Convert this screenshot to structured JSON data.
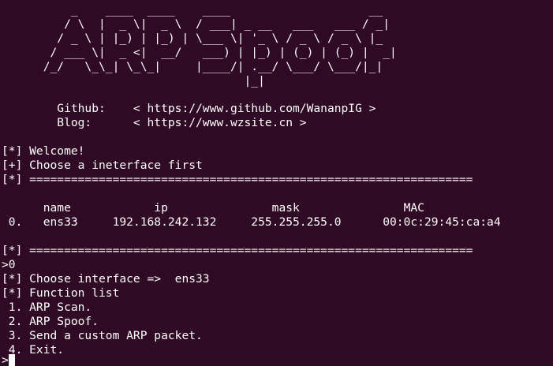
{
  "banner": [
    "          _    ____  ____    ____                    __",
    "         / \\  |  _ \\|  _ \\  / ___| _ __   ___   ___ / _|",
    "        / _ \\ | |_) | |_) | \\___ \\| '_ \\ / _ \\ / _ \\ |_",
    "       / ___ \\|  _ <|  __/   ___) | |_) | (_) | (_) |  _|",
    "      /_/   \\_\\_| \\_\\_|     |____/| .__/ \\___/ \\___/|_|",
    "                                   |_|"
  ],
  "links": {
    "github_line": "        Github:    < https://www.github.com/WananpIG >",
    "blog_line": "        Blog:      < https://www.wzsite.cn >"
  },
  "output": [
    "[*] Welcome!",
    "[+] Choose a ineterface first",
    "[*] ================================================================",
    "",
    "      name            ip               mask               MAC",
    " 0.   ens33     192.168.242.132     255.255.255.0      00:0c:29:45:ca:a4",
    "",
    "[*] ================================================================",
    ">0",
    "[*] Choose interface =>  ens33",
    "[*] Function list",
    " 1. ARP Scan.",
    " 2. ARP Spoof.",
    " 3. Send a custom ARP packet.",
    " 4. Exit.",
    ">"
  ],
  "colors": {
    "background": "#300a24",
    "foreground": "#ffffff"
  }
}
